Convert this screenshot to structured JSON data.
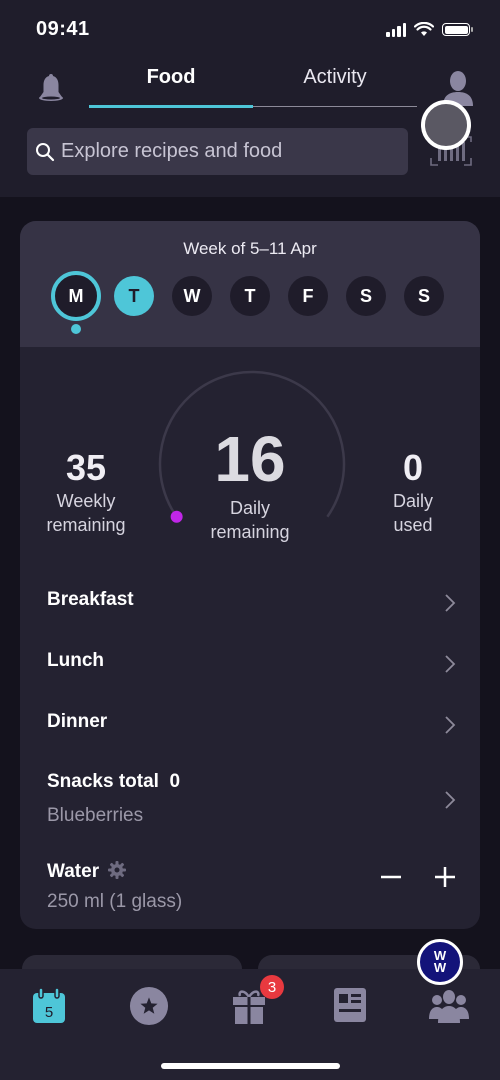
{
  "status_bar": {
    "time": "09:41"
  },
  "header": {
    "tabs": [
      {
        "label": "Food",
        "active": true
      },
      {
        "label": "Activity",
        "active": false
      }
    ],
    "search": {
      "placeholder": "Explore recipes and food"
    },
    "icons": {
      "notifications": "bell-icon",
      "profile": "person-icon",
      "barcode": "barcode-scan-icon"
    }
  },
  "colors": {
    "accent": "#4ec6d8",
    "gauge_marker": "#c026e8",
    "badge": "#e8393f",
    "brand_logo": "#13137a"
  },
  "week": {
    "title": "Week of 5–11 Apr",
    "days": [
      {
        "letter": "M",
        "state": "selected"
      },
      {
        "letter": "T",
        "state": "today"
      },
      {
        "letter": "W",
        "state": "normal"
      },
      {
        "letter": "T",
        "state": "normal"
      },
      {
        "letter": "F",
        "state": "normal"
      },
      {
        "letter": "S",
        "state": "normal"
      },
      {
        "letter": "S",
        "state": "normal"
      }
    ]
  },
  "stats": {
    "weekly": {
      "value": "35",
      "label_line1": "Weekly",
      "label_line2": "remaining"
    },
    "daily": {
      "value": "16",
      "label_line1": "Daily",
      "label_line2": "remaining",
      "used_fraction": 0
    },
    "used": {
      "value": "0",
      "label_line1": "Daily",
      "label_line2": "used"
    }
  },
  "meals": [
    {
      "title": "Breakfast"
    },
    {
      "title": "Lunch"
    },
    {
      "title": "Dinner"
    },
    {
      "title": "Snacks total  0",
      "subtitle": "Blueberries"
    }
  ],
  "water": {
    "title": "Water",
    "amount": "250 ml (1 glass)",
    "decrement_label": "−",
    "increment_label": "+"
  },
  "bottom_nav": {
    "items": [
      {
        "name": "my-day",
        "icon": "calendar-icon",
        "day_number": "5",
        "active": true
      },
      {
        "name": "favorites",
        "icon": "star-icon",
        "active": false
      },
      {
        "name": "rewards",
        "icon": "gift-icon",
        "active": false,
        "badge": "3"
      },
      {
        "name": "articles",
        "icon": "news-icon",
        "active": false
      },
      {
        "name": "community",
        "icon": "group-icon",
        "active": false
      }
    ],
    "brand_logo_text": [
      "W",
      "W"
    ]
  }
}
